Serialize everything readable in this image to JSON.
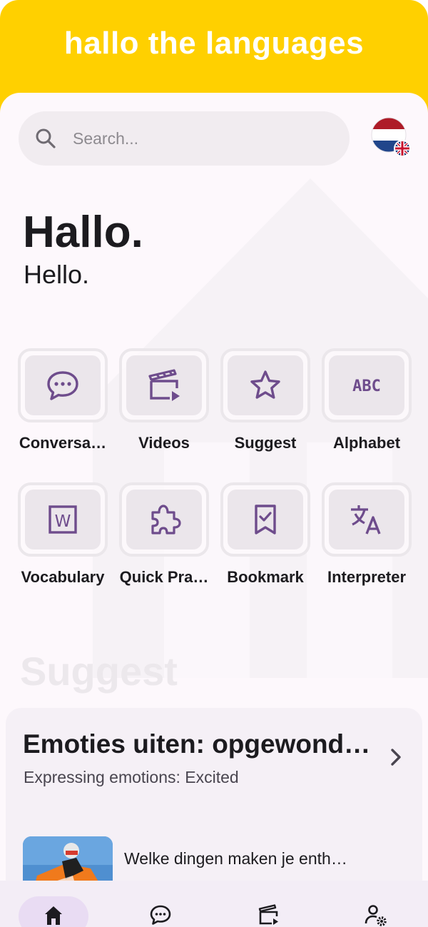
{
  "header": {
    "title": "hallo the languages"
  },
  "search": {
    "placeholder": "Search..."
  },
  "language": {
    "flag_primary": "netherlands-flag",
    "flag_secondary": "uk-flag"
  },
  "greeting": {
    "primary": "Hallo.",
    "secondary": "Hello."
  },
  "tiles": [
    {
      "label": "Conversa…",
      "icon": "chat-bubble-icon"
    },
    {
      "label": "Videos",
      "icon": "clapperboard-icon"
    },
    {
      "label": "Suggest",
      "icon": "star-icon"
    },
    {
      "label": "Alphabet",
      "icon": "abc-icon"
    },
    {
      "label": "Vocabulary",
      "icon": "word-doc-icon"
    },
    {
      "label": "Quick Pra…",
      "icon": "puzzle-icon"
    },
    {
      "label": "Bookmark",
      "icon": "bookmark-check-icon"
    },
    {
      "label": "Interpreter",
      "icon": "translate-icon"
    }
  ],
  "suggest": {
    "section_title": "Suggest",
    "card_title": "Emoties uiten: opgewond…",
    "card_subtitle": "Expressing emotions: Excited",
    "item_text": "Welke dingen maken je enth…"
  },
  "nav": [
    {
      "icon": "home-icon",
      "active": true
    },
    {
      "icon": "chat-icon",
      "active": false
    },
    {
      "icon": "clapperboard-icon",
      "active": false
    },
    {
      "icon": "user-settings-icon",
      "active": false
    }
  ],
  "colors": {
    "brand": "#ffd000",
    "accent": "#6e4c8c",
    "background": "#fdf8fc"
  }
}
